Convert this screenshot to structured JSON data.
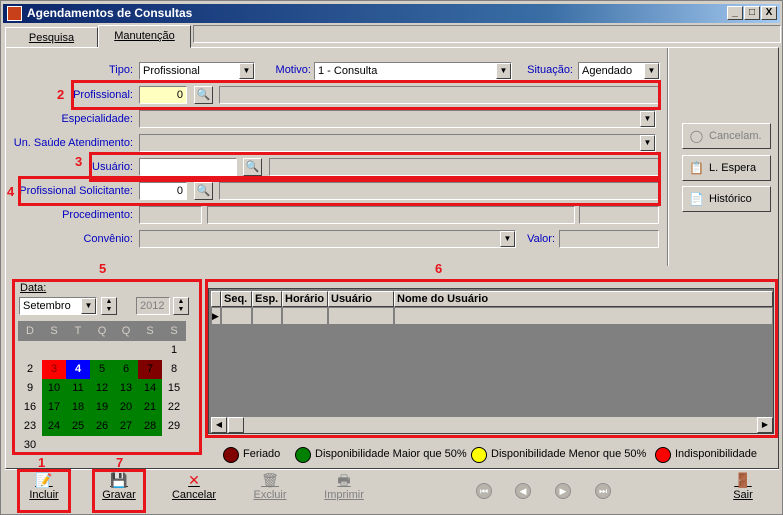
{
  "window": {
    "title": "Agendamentos de Consultas",
    "min": "_",
    "max": "□",
    "close": "X"
  },
  "tabs": [
    {
      "label": "Pesquisa"
    },
    {
      "label": "Manutenção"
    }
  ],
  "form": {
    "tipo_label": "Tipo:",
    "tipo_value": "Profissional",
    "motivo_label": "Motivo:",
    "motivo_value": "1 - Consulta",
    "situacao_label": "Situação:",
    "situacao_value": "Agendado",
    "profissional_label": "Profissional:",
    "profissional_value": "0",
    "especialidade_label": "Especialidade:",
    "unidade_label": "Un. Saúde Atendimento:",
    "usuario_label": "Usuário:",
    "solicitante_label": "Profissional Solicitante:",
    "solicitante_value": "0",
    "procedimento_label": "Procedimento:",
    "convenio_label": "Convênio:",
    "valor_label": "Valor:"
  },
  "side_buttons": [
    {
      "label": "Cancelam."
    },
    {
      "label": "L. Espera"
    },
    {
      "label": "Histórico"
    }
  ],
  "annotations": [
    "1",
    "2",
    "3",
    "4",
    "5",
    "6",
    "7"
  ],
  "calendar": {
    "label": "Data:",
    "month": "Setembro",
    "year": "2012",
    "weekdays": [
      "D",
      "S",
      "T",
      "Q",
      "Q",
      "S",
      "S"
    ],
    "days": [
      "1",
      "2",
      "3",
      "4",
      "5",
      "6",
      "7",
      "8",
      "9",
      "10",
      "11",
      "12",
      "13",
      "14",
      "15",
      "16",
      "17",
      "18",
      "19",
      "20",
      "21",
      "22",
      "23",
      "24",
      "25",
      "26",
      "27",
      "28",
      "29",
      "30"
    ]
  },
  "grid": {
    "columns": [
      "Seq.",
      "Esp.",
      "Horário",
      "Usuário",
      "Nome do Usuário"
    ]
  },
  "legend": [
    {
      "label": "Feriado",
      "color": "#800000"
    },
    {
      "label": "Disponibilidade Maior que 50%",
      "color": "#008000"
    },
    {
      "label": "Disponibilidade Menor que 50%",
      "color": "#ffff00"
    },
    {
      "label": "Indisponibilidade",
      "color": "#ff0000"
    }
  ],
  "toolbar": {
    "incluir": "Incluir",
    "gravar": "Gravar",
    "cancelar": "Cancelar",
    "excluir": "Excluir",
    "imprimir": "Imprimir",
    "sair": "Sair"
  }
}
